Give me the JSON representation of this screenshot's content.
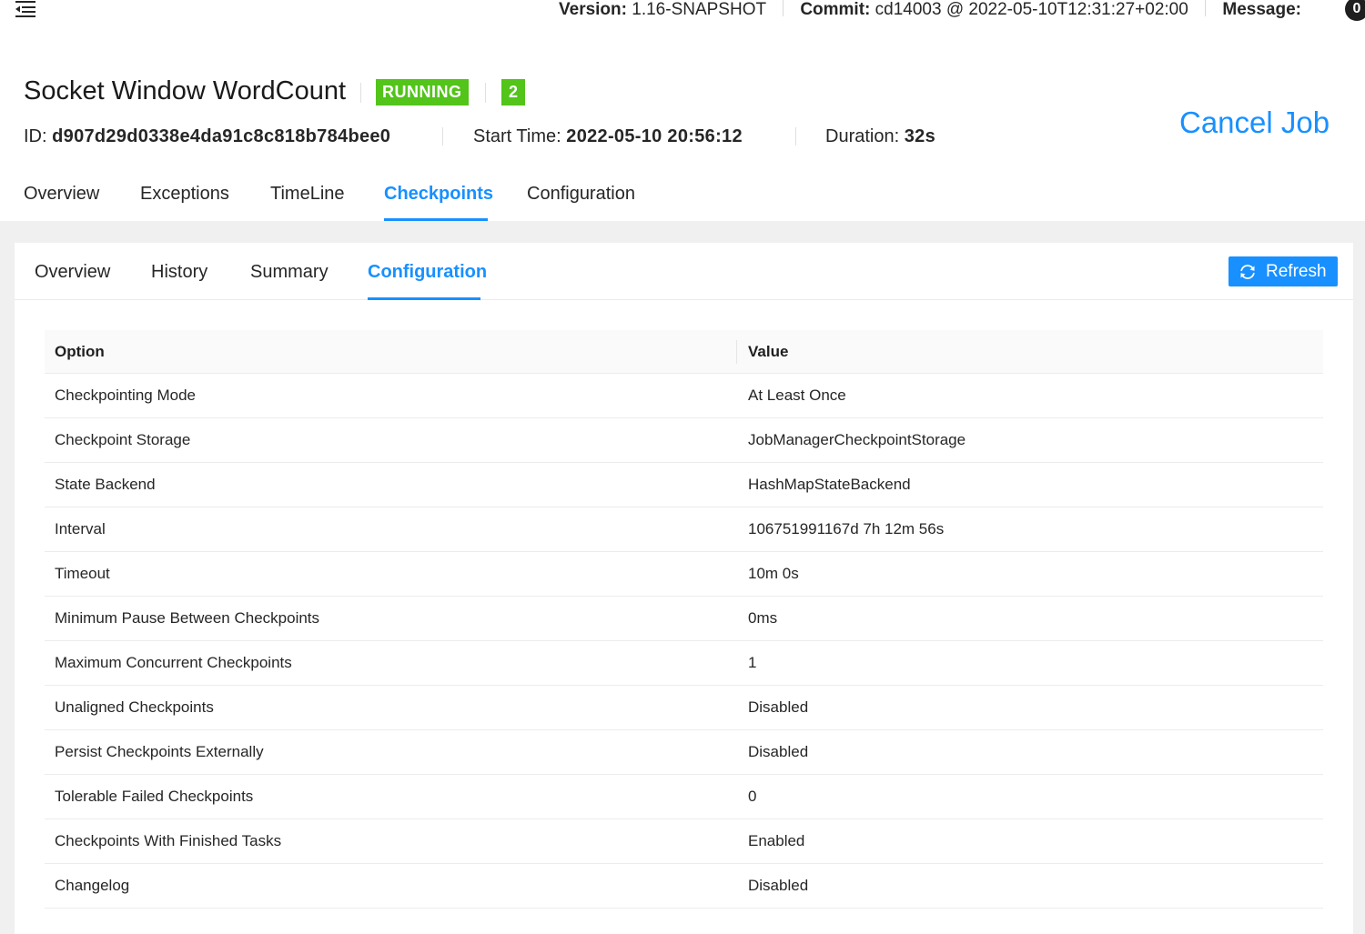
{
  "topbar": {
    "version_label": "Version:",
    "version_value": "1.16-SNAPSHOT",
    "commit_label": "Commit:",
    "commit_value": "cd14003 @ 2022-05-10T12:31:27+02:00",
    "message_label": "Message:",
    "message_count": "0"
  },
  "job": {
    "title": "Socket Window WordCount",
    "status": "RUNNING",
    "parallel_count": "2",
    "id_label": "ID:",
    "id_value": "d907d29d0338e4da91c8c818b784bee0",
    "start_label": "Start Time:",
    "start_value": "2022-05-10 20:56:12",
    "duration_label": "Duration:",
    "duration_value": "32s",
    "cancel_label": "Cancel Job"
  },
  "job_tabs": [
    {
      "label": "Overview",
      "active": false
    },
    {
      "label": "Exceptions",
      "active": false
    },
    {
      "label": "TimeLine",
      "active": false
    },
    {
      "label": "Checkpoints",
      "active": true
    },
    {
      "label": "Configuration",
      "active": false
    }
  ],
  "sub_tabs": [
    {
      "label": "Overview",
      "active": false
    },
    {
      "label": "History",
      "active": false
    },
    {
      "label": "Summary",
      "active": false
    },
    {
      "label": "Configuration",
      "active": true
    }
  ],
  "refresh_label": "Refresh",
  "table": {
    "headers": [
      "Option",
      "Value"
    ],
    "rows": [
      [
        "Checkpointing Mode",
        "At Least Once"
      ],
      [
        "Checkpoint Storage",
        "JobManagerCheckpointStorage"
      ],
      [
        "State Backend",
        "HashMapStateBackend"
      ],
      [
        "Interval",
        "106751991167d 7h 12m 56s"
      ],
      [
        "Timeout",
        "10m 0s"
      ],
      [
        "Minimum Pause Between Checkpoints",
        "0ms"
      ],
      [
        "Maximum Concurrent Checkpoints",
        "1"
      ],
      [
        "Unaligned Checkpoints",
        "Disabled"
      ],
      [
        "Persist Checkpoints Externally",
        "Disabled"
      ],
      [
        "Tolerable Failed Checkpoints",
        "0"
      ],
      [
        "Checkpoints With Finished Tasks",
        "Enabled"
      ],
      [
        "Changelog",
        "Disabled"
      ]
    ]
  },
  "colors": {
    "accent": "#1890ff",
    "status_green": "#52c41a"
  },
  "icons": {
    "menu": "menu-fold-icon",
    "refresh": "sync-icon"
  }
}
